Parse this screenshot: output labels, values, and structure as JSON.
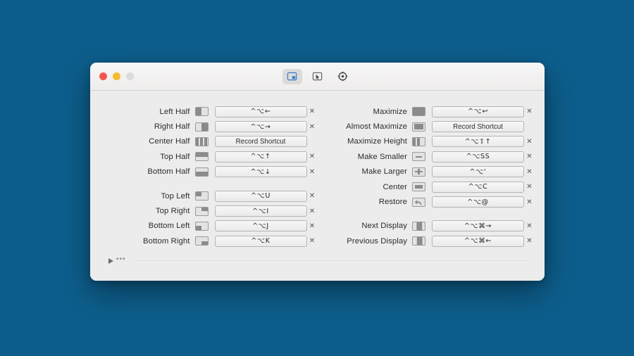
{
  "window": {
    "traffic_lights": [
      {
        "name": "close",
        "color": "#f6544c"
      },
      {
        "name": "minimize",
        "color": "#f7bc2e"
      },
      {
        "name": "zoom",
        "color": "#dcdcdc"
      }
    ],
    "toolbar": [
      {
        "name": "snap-areas-tab",
        "icon": "window-thirds-icon",
        "active": true
      },
      {
        "name": "drag-snap-tab",
        "icon": "window-cursor-icon",
        "active": false
      },
      {
        "name": "preferences-tab",
        "icon": "gear-icon",
        "active": false
      }
    ]
  },
  "desktop": {
    "background": "#0d5e8c"
  },
  "accent_color": "#3b7ecb",
  "footer": {
    "disclosure_label": "▶",
    "more_label": "•••"
  },
  "labels": {
    "record_shortcut": "Record Shortcut",
    "clear": "✕"
  },
  "left_column": [
    {
      "label": "Left Half",
      "glyph": "half-left",
      "shortcut": "^⌥←",
      "recorded": true,
      "group": 0
    },
    {
      "label": "Right Half",
      "glyph": "half-right",
      "shortcut": "^⌥→",
      "recorded": true,
      "group": 0
    },
    {
      "label": "Center Half",
      "glyph": "half-center",
      "shortcut": "Record Shortcut",
      "recorded": false,
      "group": 0
    },
    {
      "label": "Top Half",
      "glyph": "half-top",
      "shortcut": "^⌥↑",
      "recorded": true,
      "group": 0
    },
    {
      "label": "Bottom Half",
      "glyph": "half-bottom",
      "shortcut": "^⌥↓",
      "recorded": true,
      "group": 0
    },
    {
      "label": "Top Left",
      "glyph": "quad-top-left",
      "shortcut": "^⌥U",
      "recorded": true,
      "group": 1
    },
    {
      "label": "Top Right",
      "glyph": "quad-top-right",
      "shortcut": "^⌥I",
      "recorded": true,
      "group": 1
    },
    {
      "label": "Bottom Left",
      "glyph": "quad-bottom-left",
      "shortcut": "^⌥J",
      "recorded": true,
      "group": 1
    },
    {
      "label": "Bottom Right",
      "glyph": "quad-bottom-right",
      "shortcut": "^⌥K",
      "recorded": true,
      "group": 1
    }
  ],
  "right_column": [
    {
      "label": "Maximize",
      "glyph": "maximize",
      "shortcut": "^⌥↩",
      "recorded": true,
      "group": 0
    },
    {
      "label": "Almost Maximize",
      "glyph": "almost-maximize",
      "shortcut": "Record Shortcut",
      "recorded": false,
      "group": 0
    },
    {
      "label": "Maximize Height",
      "glyph": "maximize-height",
      "shortcut": "^⌥⇧↑",
      "recorded": true,
      "group": 0
    },
    {
      "label": "Make Smaller",
      "glyph": "minus",
      "shortcut": "^⌥SS",
      "recorded": true,
      "group": 0
    },
    {
      "label": "Make Larger",
      "glyph": "plus",
      "shortcut": "^⌥‘",
      "recorded": true,
      "group": 0
    },
    {
      "label": "Center",
      "glyph": "center",
      "shortcut": "^⌥C",
      "recorded": true,
      "group": 0
    },
    {
      "label": "Restore",
      "glyph": "restore-arrow",
      "shortcut": "^⌥@",
      "recorded": true,
      "group": 0
    },
    {
      "label": "Next Display",
      "glyph": "display-next",
      "shortcut": "^⌥⌘→",
      "recorded": true,
      "group": 1
    },
    {
      "label": "Previous Display",
      "glyph": "display-prev",
      "shortcut": "^⌥⌘←",
      "recorded": true,
      "group": 1
    }
  ]
}
